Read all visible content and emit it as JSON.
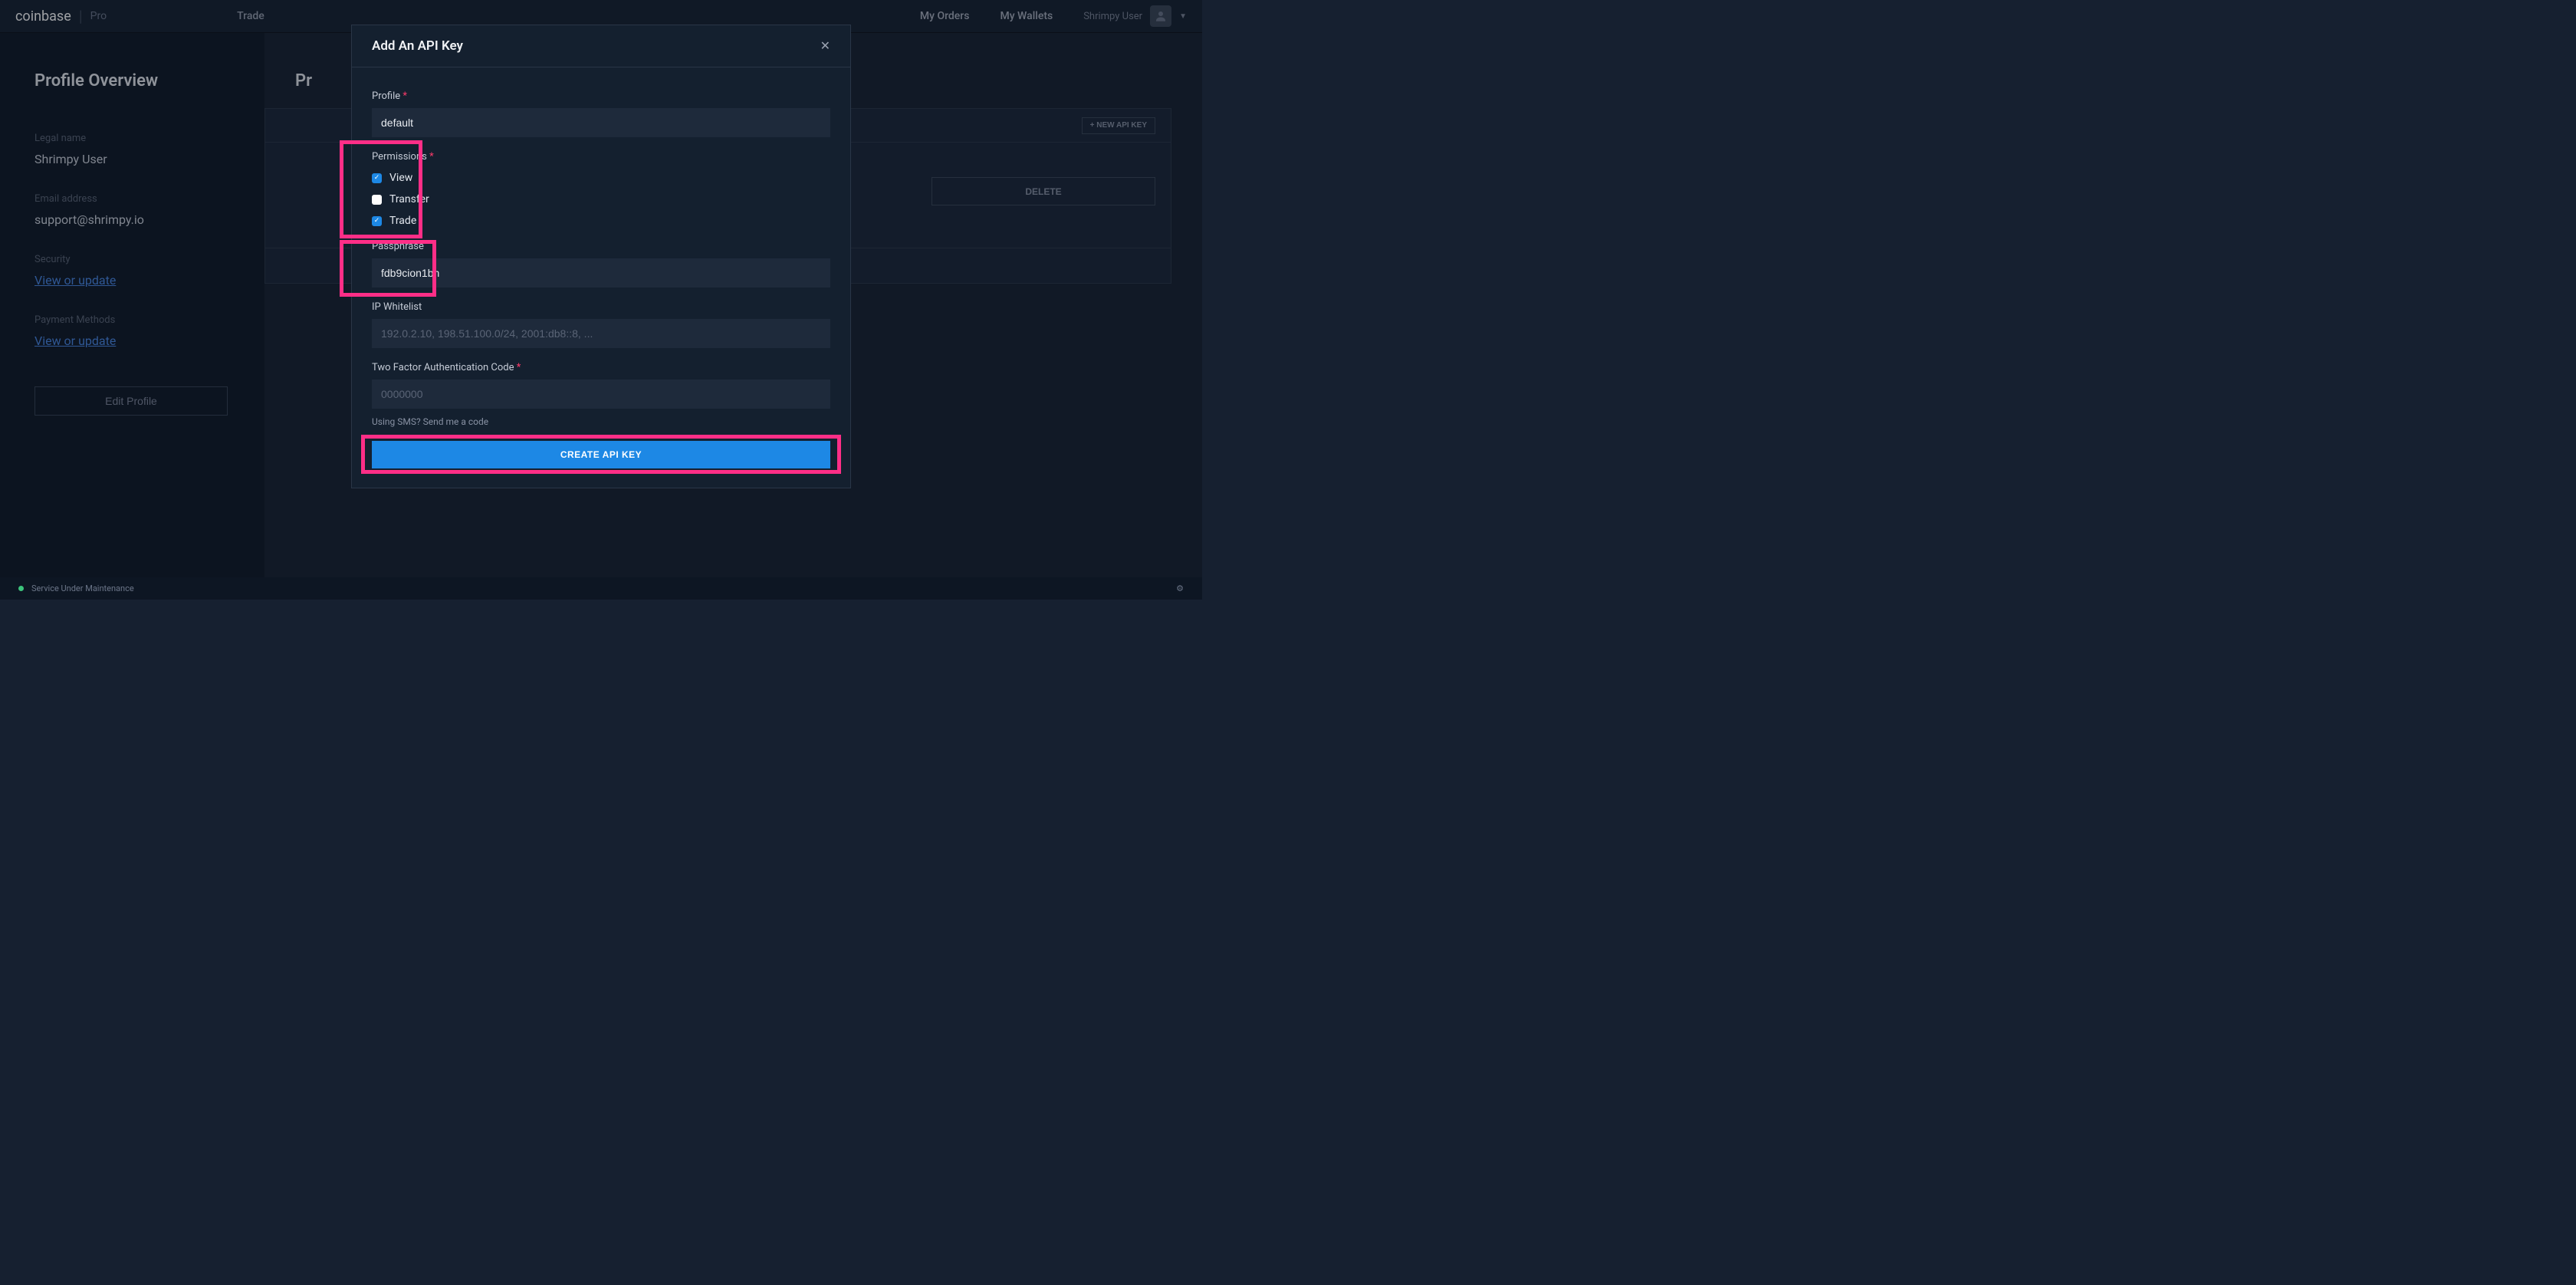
{
  "header": {
    "logo_main": "coinbase",
    "logo_sub": "Pro",
    "trade": "Trade",
    "orders": "My Orders",
    "wallets": "My Wallets",
    "username": "Shrimpy User"
  },
  "sidebar": {
    "title": "Profile Overview",
    "legal_name_label": "Legal name",
    "legal_name_value": "Shrimpy User",
    "email_label": "Email address",
    "email_value": "support@shrimpy.io",
    "security_label": "Security",
    "security_link": "View or update",
    "payment_label": "Payment Methods",
    "payment_link": "View or update",
    "edit_btn": "Edit Profile"
  },
  "content": {
    "title_partial": "Pr",
    "new_api_btn": "+ NEW API KEY",
    "delete_btn": "DELETE"
  },
  "modal": {
    "title": "Add An API Key",
    "profile_label": "Profile",
    "profile_value": "default",
    "permissions_label": "Permissions",
    "perm_view": "View",
    "perm_transfer": "Transfer",
    "perm_trade": "Trade",
    "passphrase_label": "Passphrase",
    "passphrase_value": "fdb9cion1bh",
    "ip_label": "IP Whitelist",
    "ip_placeholder": "192.0.2.10, 198.51.100.0/24, 2001:db8::8, ...",
    "tfa_label": "Two Factor Authentication Code",
    "tfa_placeholder": "0000000",
    "sms_text": "Using SMS? Send me a code",
    "create_btn": "CREATE API KEY"
  },
  "status": {
    "text": "Service Under Maintenance"
  }
}
